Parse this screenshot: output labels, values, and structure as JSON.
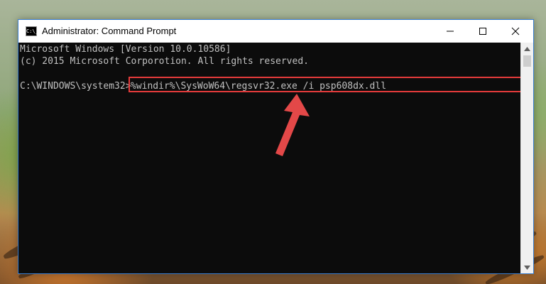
{
  "window": {
    "title": "Administrator: Command Prompt",
    "icon_label": "C:\\_",
    "icon_name": "cmd-app-icon",
    "controls": {
      "minimize": "minimize-icon",
      "maximize": "maximize-icon",
      "close": "close-icon"
    }
  },
  "console": {
    "lines": [
      "Microsoft Windows [Version 10.0.10586]",
      "(c) 2015 Microsoft Corporotion. All rights reserved."
    ],
    "prompt": "C:\\WINDOWS\\system32>",
    "command": "%windir%\\SysWoW64\\regsvr32.exe /i psp608dx.dll"
  },
  "annotation": {
    "highlight_color": "#e53b3b",
    "arrow_icon": "red-arrow-icon"
  },
  "colors": {
    "console_bg": "#0c0c0c",
    "console_text": "#c0c0c0",
    "window_border": "#3b7fd0"
  }
}
